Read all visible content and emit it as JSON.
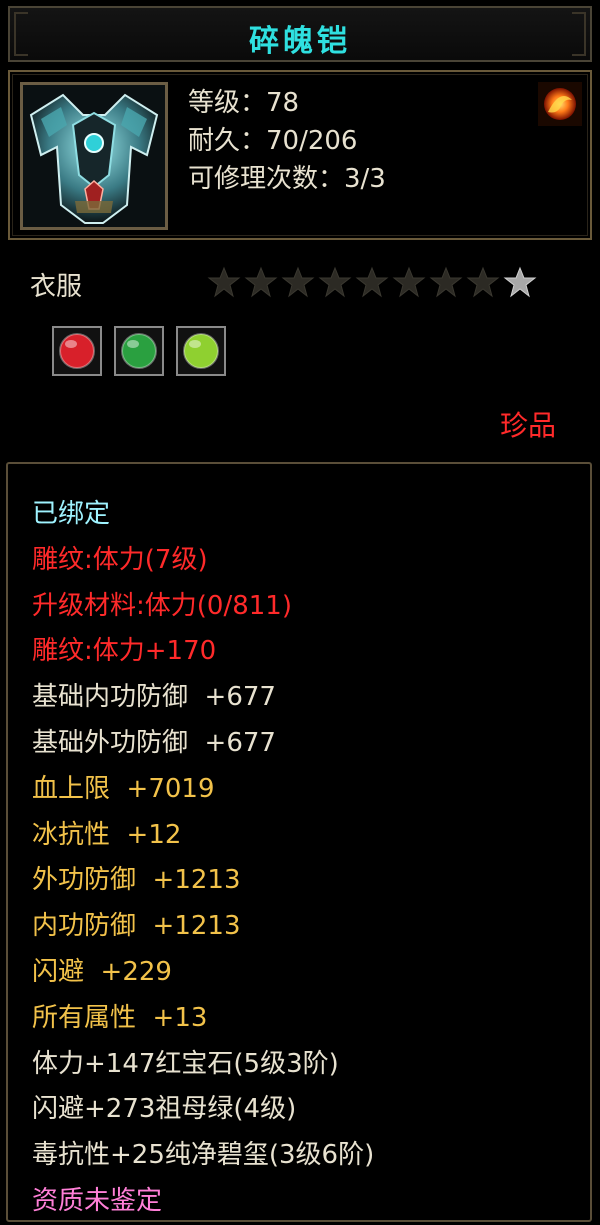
{
  "colors": {
    "title": "#2fe0e0",
    "white": "#e8e2d0",
    "red": "#ff2a2a",
    "yellow": "#f2c24a",
    "cyan": "#9ff3ff",
    "pink": "#ff7fd7"
  },
  "item": {
    "name": "碎魄铠",
    "icon": "armor-icon",
    "corner_icon": "fire-orb-icon",
    "stats": [
      "等级：78",
      "耐久：70/206",
      "可修理次数：3/3"
    ],
    "type": "衣服",
    "stars_total": 9,
    "stars_filled": 8,
    "gems": [
      {
        "name": "red-gem-icon",
        "color": "#d8202a"
      },
      {
        "name": "green-gem-icon",
        "color": "#2aa040"
      },
      {
        "name": "olive-gem-icon",
        "color": "#8fd030"
      }
    ],
    "quality": "珍品"
  },
  "attributes": [
    {
      "text": "已绑定",
      "color": "#9ff3ff"
    },
    {
      "text": "雕纹:体力(7级)",
      "color": "#ff2a2a"
    },
    {
      "text": "升级材料:体力(0/811)",
      "color": "#ff2a2a"
    },
    {
      "text": "雕纹:体力+170",
      "color": "#ff2a2a"
    },
    {
      "text": "基础内功防御  +677",
      "color": "#e8e2d0"
    },
    {
      "text": "基础外功防御  +677",
      "color": "#e8e2d0"
    },
    {
      "text": "血上限  +7019",
      "color": "#f2c24a"
    },
    {
      "text": "冰抗性  +12",
      "color": "#f2c24a"
    },
    {
      "text": "外功防御  +1213",
      "color": "#f2c24a"
    },
    {
      "text": "内功防御  +1213",
      "color": "#f2c24a"
    },
    {
      "text": "闪避  +229",
      "color": "#f2c24a"
    },
    {
      "text": "所有属性  +13",
      "color": "#f2c24a"
    },
    {
      "text": "体力+147红宝石(5级3阶)",
      "color": "#e8e2d0"
    },
    {
      "text": "闪避+273祖母绿(4级)",
      "color": "#e8e2d0"
    },
    {
      "text": "毒抗性+25纯净碧玺(3级6阶)",
      "color": "#e8e2d0"
    },
    {
      "text": "资质未鉴定",
      "color": "#ff7fd7"
    }
  ]
}
